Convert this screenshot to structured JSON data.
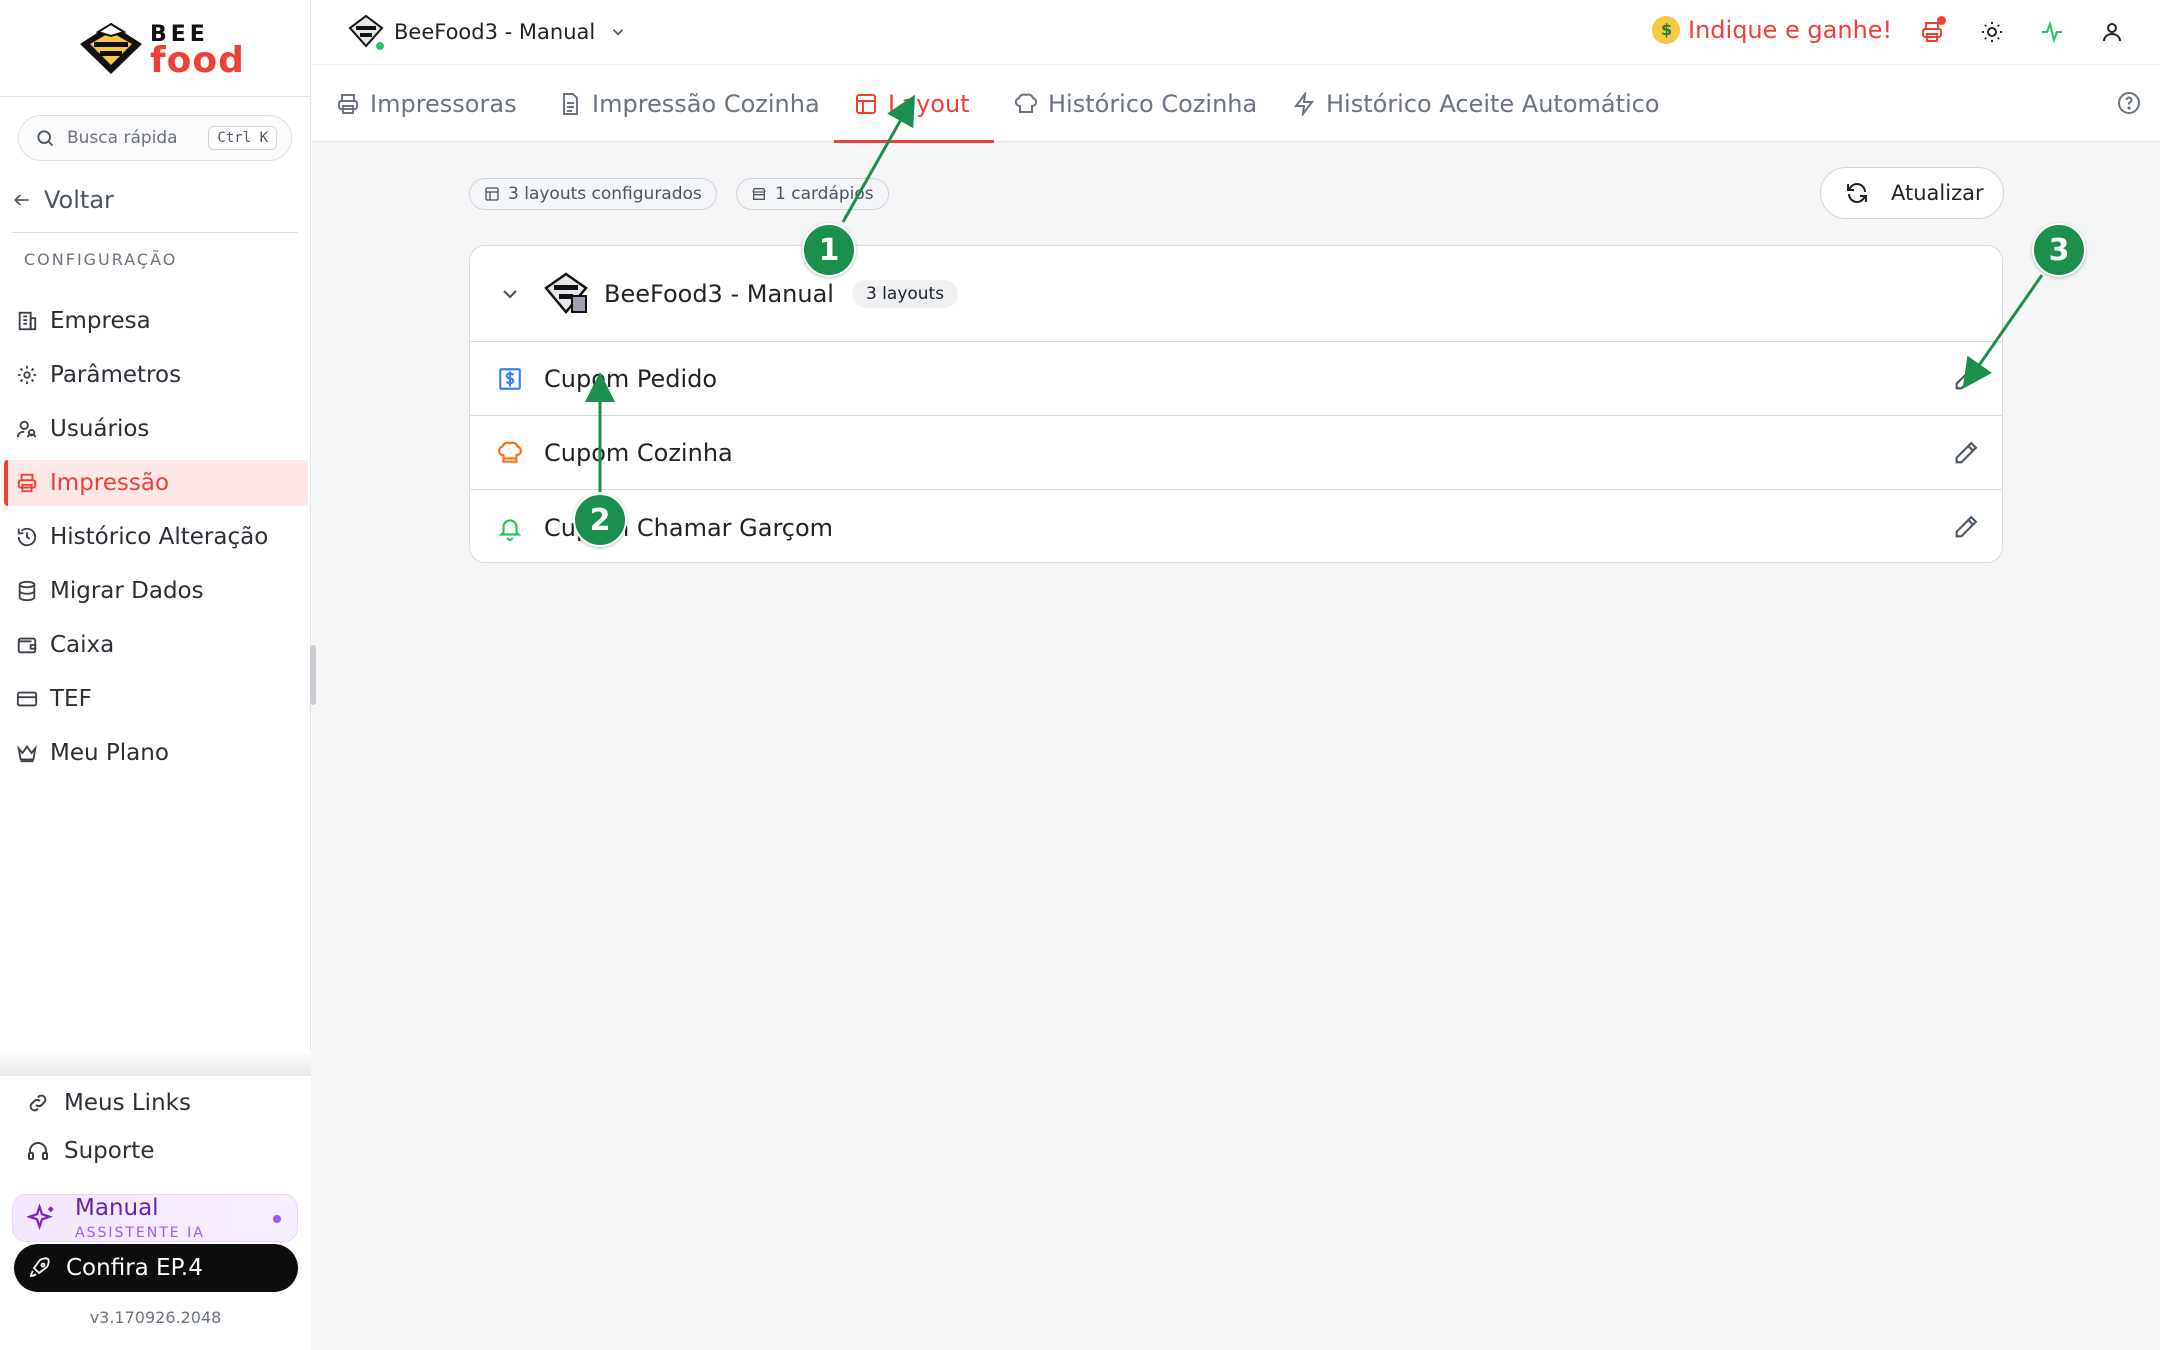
{
  "sidebar": {
    "logo": {
      "line1": "BEE",
      "line2": "food"
    },
    "search": {
      "placeholder": "Busca rápida",
      "shortcut": "Ctrl K"
    },
    "back_label": "Voltar",
    "section_title": "CONFIGURAÇÃO",
    "items": [
      {
        "label": "Empresa",
        "icon": "building-icon",
        "active": false
      },
      {
        "label": "Parâmetros",
        "icon": "gear-icon",
        "active": false
      },
      {
        "label": "Usuários",
        "icon": "users-icon",
        "active": false
      },
      {
        "label": "Impressão",
        "icon": "printer-icon",
        "active": true
      },
      {
        "label": "Histórico Alteração",
        "icon": "history-icon",
        "active": false
      },
      {
        "label": "Migrar Dados",
        "icon": "database-icon",
        "active": false
      },
      {
        "label": "Caixa",
        "icon": "wallet-icon",
        "active": false
      },
      {
        "label": "TEF",
        "icon": "card-icon",
        "active": false
      },
      {
        "label": "Meu Plano",
        "icon": "crown-icon",
        "active": false
      }
    ],
    "bottom": {
      "links_label": "Meus Links",
      "support_label": "Suporte",
      "assistant": {
        "title": "Manual",
        "subtitle": "ASSISTENTE IA"
      },
      "episode_label": "Confira EP.4",
      "version": "v3.170926.2048"
    }
  },
  "topbar": {
    "store_name": "BeeFood3 - Manual",
    "referral_label": "Indique e ganhe!",
    "accent_color": "#ef4036",
    "online_color": "#22c55e"
  },
  "tabs": [
    {
      "label": "Impressoras",
      "icon": "printer-icon",
      "active": false
    },
    {
      "label": "Impressão Cozinha",
      "icon": "document-icon",
      "active": false
    },
    {
      "label": "Layout",
      "icon": "layout-icon",
      "active": true
    },
    {
      "label": "Histórico Cozinha",
      "icon": "chef-hat-icon",
      "active": false
    },
    {
      "label": "Histórico Aceite Automático",
      "icon": "bolt-icon",
      "active": false
    }
  ],
  "summary": {
    "layouts_chip": "3 layouts configurados",
    "menus_chip": "1 cardápios",
    "refresh_label": "Atualizar"
  },
  "group": {
    "name": "BeeFood3 - Manual",
    "badge": "3 layouts",
    "rows": [
      {
        "label": "Cupom Pedido",
        "icon": "dollar-receipt-icon",
        "icon_color": "#3b82f6"
      },
      {
        "label": "Cupom Cozinha",
        "icon": "chef-hat-icon",
        "icon_color": "#f97316"
      },
      {
        "label": "Cupom Chamar Garçom",
        "icon": "bell-icon",
        "icon_color": "#22c55e"
      }
    ]
  },
  "annotations": {
    "markers": [
      "1",
      "2",
      "3"
    ],
    "color": "#1a8f4e"
  }
}
